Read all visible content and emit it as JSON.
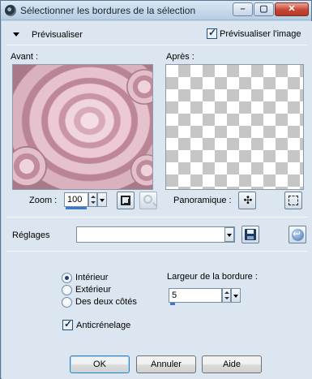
{
  "window": {
    "title": "Sélectionner les bordures de la sélection",
    "minimize_glyph": "–",
    "maximize_glyph": "▢",
    "close_glyph": "✕"
  },
  "preview": {
    "toggle_label": "Prévisualiser",
    "checkbox_label": "Prévisualiser l'image",
    "checkbox_checked": true
  },
  "before": {
    "label": "Avant :"
  },
  "after": {
    "label": "Après :"
  },
  "zoom": {
    "label": "Zoom :",
    "value": "100"
  },
  "pan": {
    "label": "Panoramique :"
  },
  "presets": {
    "label": "Réglages",
    "value": ""
  },
  "options": {
    "radios": [
      {
        "label": "Intérieur",
        "checked": true
      },
      {
        "label": "Extérieur",
        "checked": false
      },
      {
        "label": "Des deux côtés",
        "checked": false
      }
    ],
    "antialias_label": "Anticrénelage",
    "antialias_checked": true,
    "border_width_label": "Largeur de la bordure :",
    "border_width_value": "5"
  },
  "buttons": {
    "ok": "OK",
    "cancel": "Annuler",
    "help": "Aide"
  },
  "icons": [
    "app-icon",
    "collapse-triangle-icon",
    "zoom-fit-icon",
    "zoom-100-icon",
    "pan-icon",
    "selection-icon",
    "save-icon",
    "reset-icon"
  ]
}
